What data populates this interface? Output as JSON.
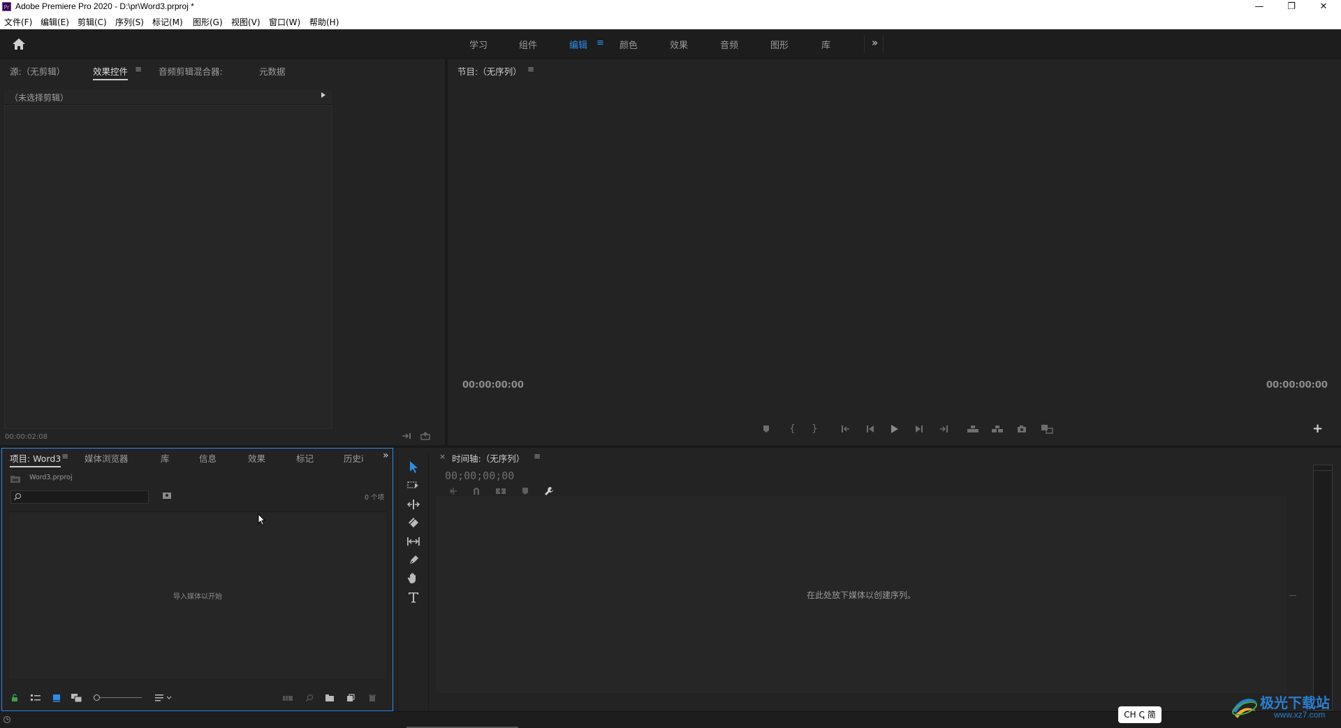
{
  "window": {
    "app_icon": "Pr",
    "title": "Adobe Premiere Pro 2020 - D:\\pr\\Word3.prproj *",
    "minimize": "—",
    "restore": "❐",
    "close": "✕"
  },
  "menubar": {
    "items": [
      "文件(F)",
      "编辑(E)",
      "剪辑(C)",
      "序列(S)",
      "标记(M)",
      "图形(G)",
      "视图(V)",
      "窗口(W)",
      "帮助(H)"
    ]
  },
  "workspaces": {
    "tabs": [
      "学习",
      "组件",
      "编辑",
      "颜色",
      "效果",
      "音频",
      "图形",
      "库"
    ],
    "active_index": 2,
    "active_menu": "≡",
    "more": "»",
    "accent_color": "#2d8ceb"
  },
  "source_panel": {
    "tabs": [
      "源:（无剪辑）",
      "效果控件",
      "音频剪辑混合器:",
      "元数据"
    ],
    "active_menu": "≡",
    "no_clip_label": "（未选择剪辑）",
    "timecode": "00:00:02:08"
  },
  "program_panel": {
    "title": "节目:（无序列）",
    "menu": "≡",
    "timecode_left": "00:00:00:00",
    "timecode_right": "00:00:00:00",
    "add_button": "+"
  },
  "project_panel": {
    "tabs": [
      "项目: Word3",
      "媒体浏览器",
      "库",
      "信息",
      "效果",
      "标记",
      "历史i"
    ],
    "menu": "≡",
    "more": "»",
    "file_name": "Word3.prproj",
    "item_count": "0 个项",
    "empty_hint": "导入媒体以开始"
  },
  "timeline_panel": {
    "close": "×",
    "title": "时间轴:（无序列）",
    "menu": "≡",
    "timecode": "00;00;00;00",
    "empty_hint": "在此处放下媒体以创建序列。"
  },
  "taskbar": {
    "ime": "CH ↅ 简"
  },
  "watermark": {
    "text": "极光下载站",
    "url": "www.xz7.com"
  }
}
